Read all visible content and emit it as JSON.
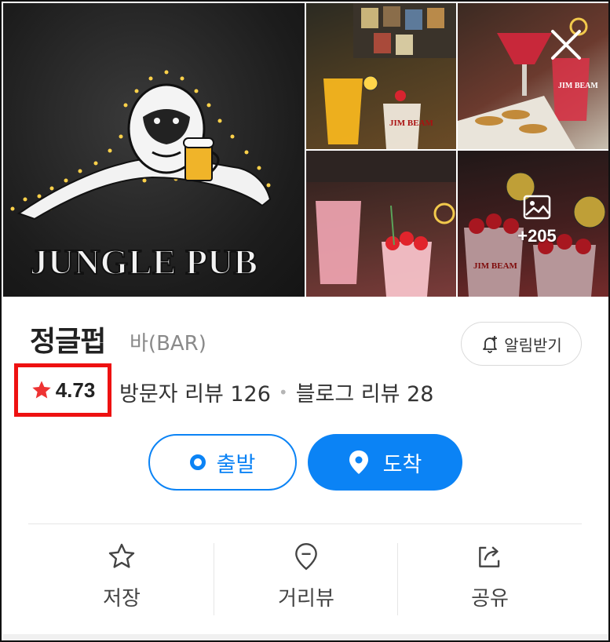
{
  "gallery": {
    "main_sign_text": "JUNGLE PUB",
    "more_photos_count": "+205"
  },
  "place": {
    "name": "정글펍",
    "category": "바(BAR)",
    "notify_label": "알림받기",
    "rating": "4.73",
    "visitor_reviews": "방문자 리뷰 126",
    "blog_reviews": "블로그 리뷰 28"
  },
  "route": {
    "start_label": "출발",
    "arrive_label": "도착"
  },
  "actions": {
    "save_label": "저장",
    "streetview_label": "거리뷰",
    "share_label": "공유"
  },
  "icons": {
    "close": "close-icon",
    "photos": "image-icon",
    "bell": "bell-plus-icon",
    "star": "star-icon",
    "pin": "location-pin-icon",
    "bookmark": "star-outline-icon",
    "streetview": "map-marker-outline-icon",
    "share": "share-icon"
  },
  "colors": {
    "accent": "#0b83f5",
    "rating_star": "#ee3333",
    "highlight_box": "#ee1111"
  }
}
